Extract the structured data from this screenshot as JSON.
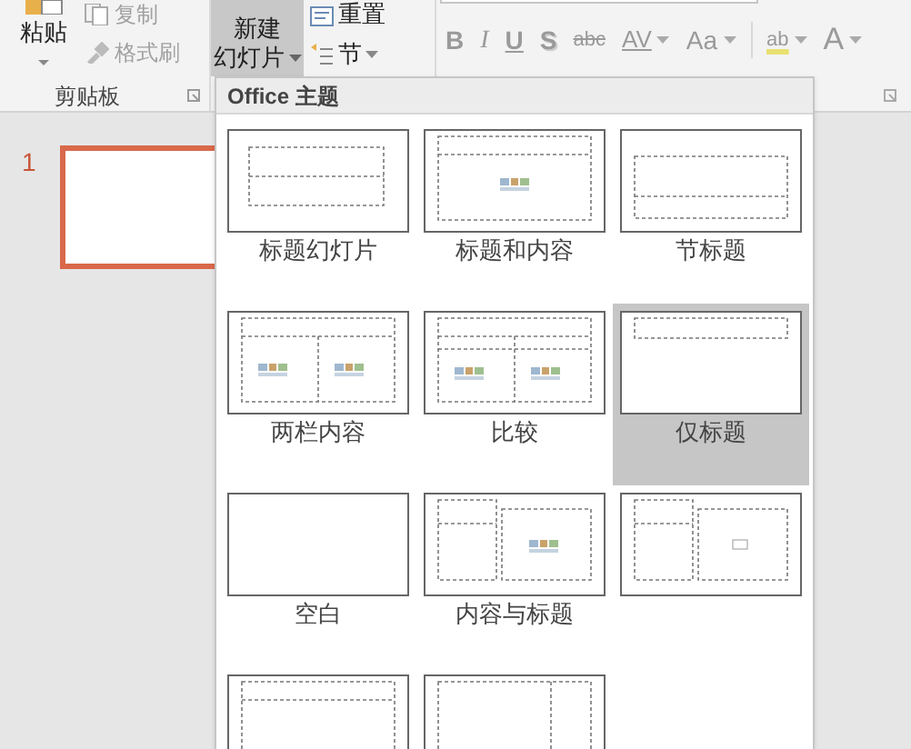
{
  "ribbon": {
    "clipboard": {
      "paste": "粘贴",
      "copy": "复制",
      "format_painter": "格式刷",
      "group_label": "剪贴板"
    },
    "slides": {
      "new_slide": [
        "新建",
        "幻灯片"
      ],
      "reset": "重置",
      "section": "节"
    },
    "font_tools": [
      {
        "kind": "bold",
        "label": "B"
      },
      {
        "kind": "italic",
        "label": "I"
      },
      {
        "kind": "underline",
        "label": "U"
      },
      {
        "kind": "shadow",
        "label": "S"
      },
      {
        "kind": "strikethrough",
        "label": "abc"
      },
      {
        "kind": "spacing",
        "label": "AV"
      },
      {
        "kind": "case",
        "label": "Aa"
      },
      {
        "kind": "highlight",
        "label": "ab"
      },
      {
        "kind": "color",
        "label": "A"
      }
    ]
  },
  "slide_pane": {
    "slides": [
      {
        "number": "1",
        "selected": true
      }
    ]
  },
  "layout_gallery": {
    "header": "Office 主题",
    "layouts": [
      {
        "kind": "title",
        "label": "标题幻灯片",
        "selected": false
      },
      {
        "kind": "title-content",
        "label": "标题和内容",
        "selected": false
      },
      {
        "kind": "section",
        "label": "节标题",
        "selected": false
      },
      {
        "kind": "two-content",
        "label": "两栏内容",
        "selected": false
      },
      {
        "kind": "comparison",
        "label": "比较",
        "selected": false
      },
      {
        "kind": "title-only",
        "label": "仅标题",
        "selected": true
      },
      {
        "kind": "blank",
        "label": "空白",
        "selected": false
      },
      {
        "kind": "content-caption",
        "label": "内容与标题",
        "selected": false
      },
      {
        "kind": "picture-caption",
        "selected": false
      },
      {
        "kind": "vertical-text",
        "selected": false
      },
      {
        "kind": "vertical-title",
        "selected": false
      }
    ]
  }
}
